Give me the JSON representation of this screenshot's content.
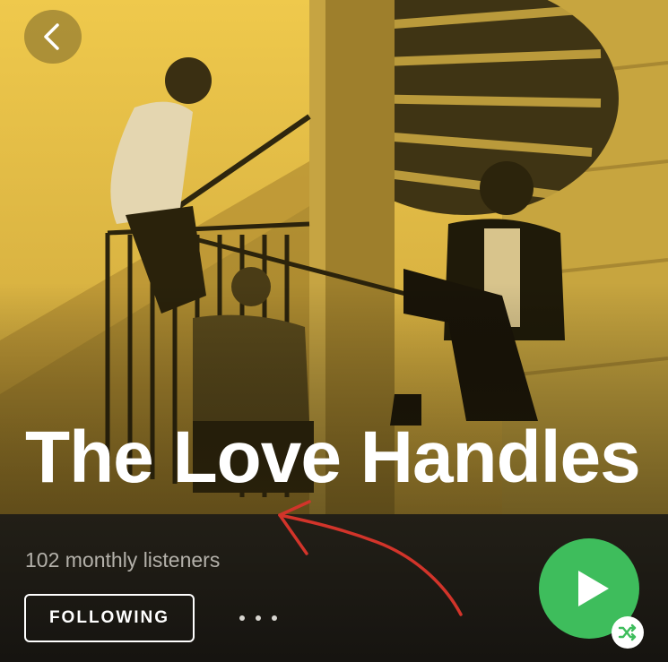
{
  "header": {
    "artist_name": "The Love Handles",
    "back_icon": "chevron-left-icon"
  },
  "stats": {
    "monthly_listeners": "102 monthly listeners"
  },
  "actions": {
    "follow_label": "FOLLOWING",
    "more_icon": "more-dots-icon",
    "play_icon": "play-icon",
    "shuffle_icon": "shuffle-icon"
  },
  "colors": {
    "hero_tint": "#e7c24a",
    "play_green": "#3ebd5c",
    "background": "#1c1a16",
    "annotation_red": "#d2342a"
  }
}
